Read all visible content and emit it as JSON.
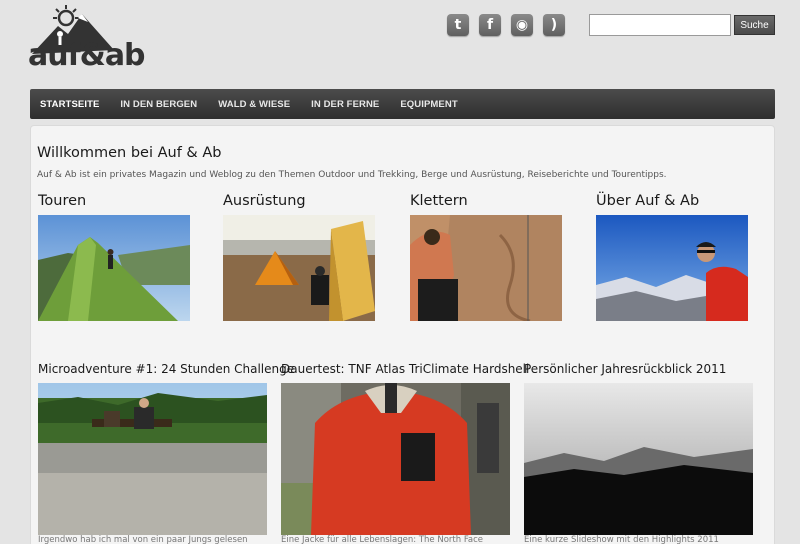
{
  "header": {
    "logo_text": "auf&ab",
    "social": [
      {
        "icon": "twitter-icon",
        "glyph": "t"
      },
      {
        "icon": "facebook-icon",
        "glyph": "f"
      },
      {
        "icon": "podcast-icon",
        "glyph": "◉"
      },
      {
        "icon": "rss-icon",
        "glyph": ")"
      }
    ],
    "search": {
      "placeholder": "",
      "value": "",
      "button_label": "Suche"
    }
  },
  "nav": {
    "items": [
      "STARTSEITE",
      "IN DEN BERGEN",
      "WALD & WIESE",
      "IN DER FERNE",
      "EQUIPMENT"
    ],
    "active_index": 0
  },
  "intro": {
    "title": "Willkommen bei Auf & Ab",
    "text": "Auf & Ab ist ein privates Magazin und Weblog zu den Themen Outdoor und Trekking, Berge und Ausrüstung, Reiseberichte und Tourentipps."
  },
  "categories": [
    {
      "title": "Touren"
    },
    {
      "title": "Ausrüstung"
    },
    {
      "title": "Klettern"
    },
    {
      "title": "Über Auf & Ab"
    }
  ],
  "posts": [
    {
      "title": "Microadventure #1: 24 Stunden Challenge",
      "excerpt": "Irgendwo hab ich mal von ein paar Jungs gelesen"
    },
    {
      "title": "Dauertest: TNF Atlas TriClimate Hardshell",
      "excerpt": "Eine Jacke für alle Lebenslagen: The North Face"
    },
    {
      "title": "Persönlicher Jahresrückblick 2011",
      "excerpt": "Eine kurze Slideshow mit den Highlights 2011"
    }
  ],
  "colors": {
    "background": "#e4e4e4",
    "nav": "#3a3a3a",
    "panel": "#f4f4f4"
  }
}
